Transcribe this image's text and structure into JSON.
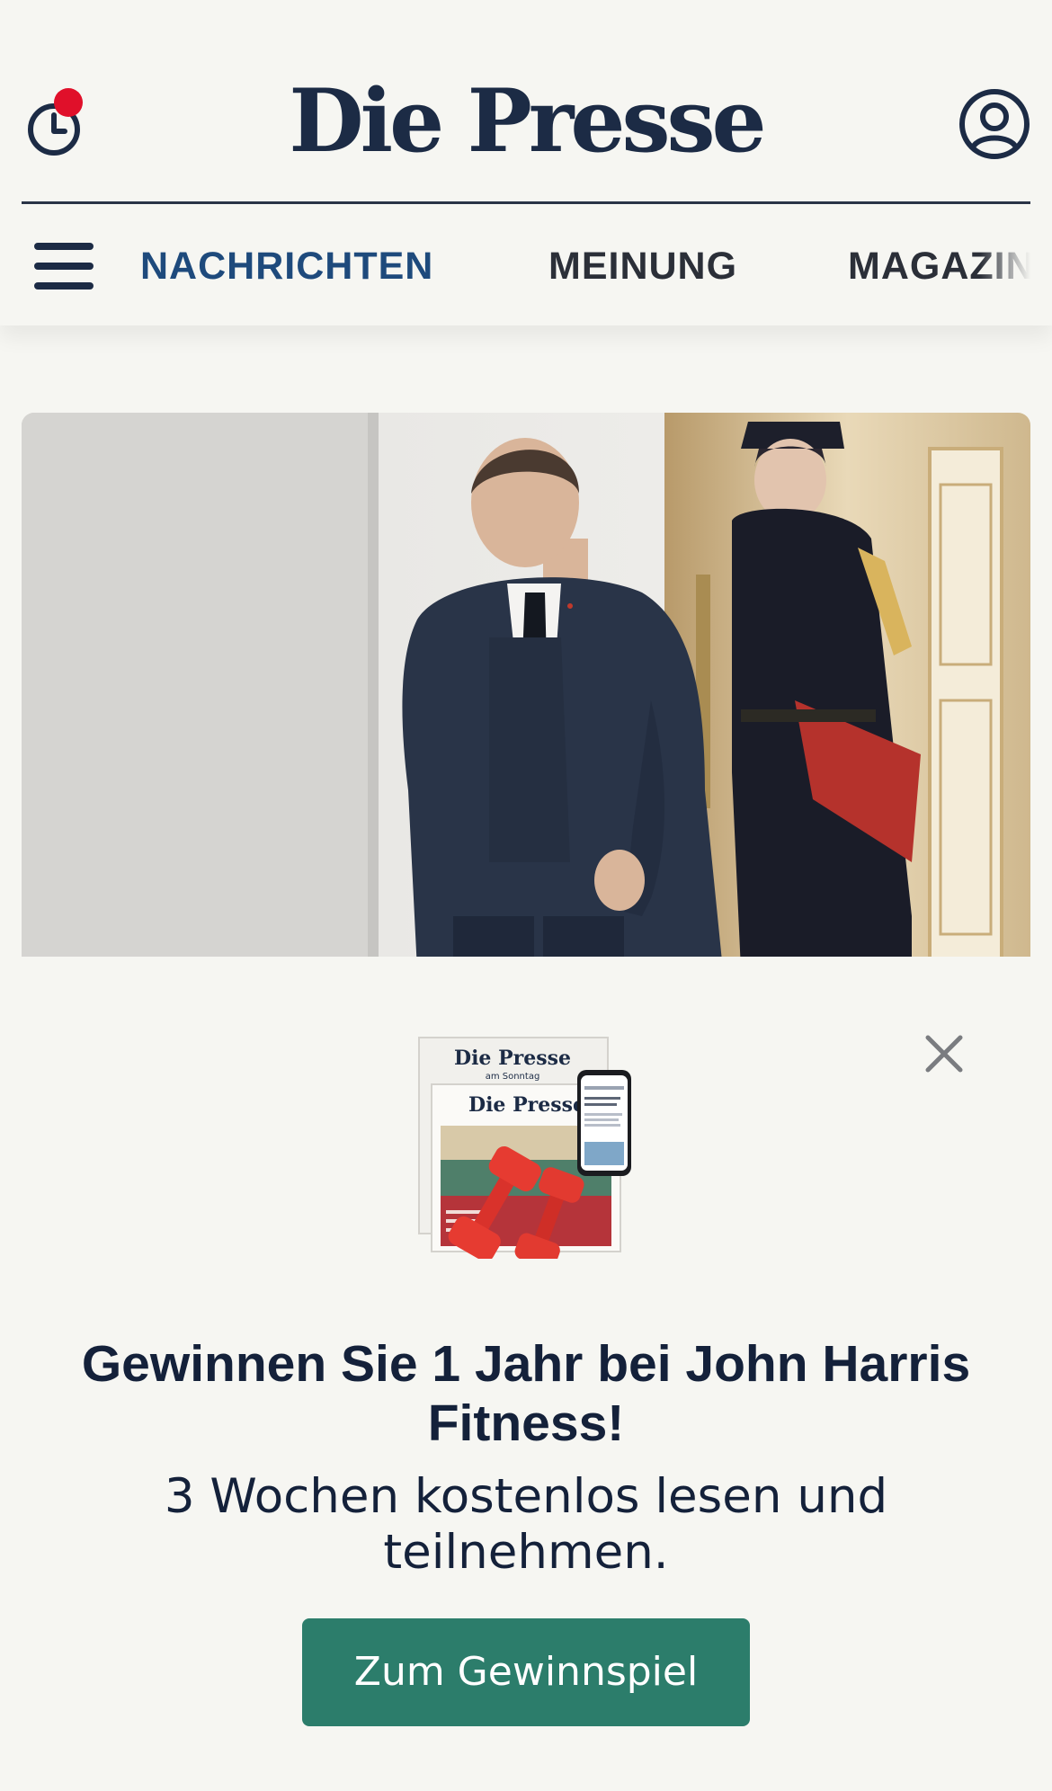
{
  "header": {
    "brand": "Die Presse",
    "nav": {
      "tabs": [
        {
          "label": "NACHRICHTEN",
          "active": true
        },
        {
          "label": "MEINUNG",
          "active": false
        },
        {
          "label": "MAGAZIN",
          "active": false
        }
      ]
    },
    "notification": true
  },
  "promo": {
    "illustration": {
      "paper_back_title": "Die Presse",
      "paper_back_subtitle": "am Sonntag",
      "paper_front_title": "Die Presse"
    },
    "title": "Gewinnen Sie 1 Jahr bei John Harris Fitness!",
    "subtitle": "3 Wochen kostenlos lesen und teilnehmen.",
    "cta": "Zum Gewinnspiel"
  },
  "colors": {
    "background": "#f6f6f2",
    "brand": "#1c2b45",
    "nav_active": "#1e4a7c",
    "notification_dot": "#e0102a",
    "cta": "#2c7d6b"
  },
  "icons": [
    "history-icon",
    "account-icon",
    "hamburger-menu-icon",
    "close-icon",
    "dumbbell-icon"
  ]
}
